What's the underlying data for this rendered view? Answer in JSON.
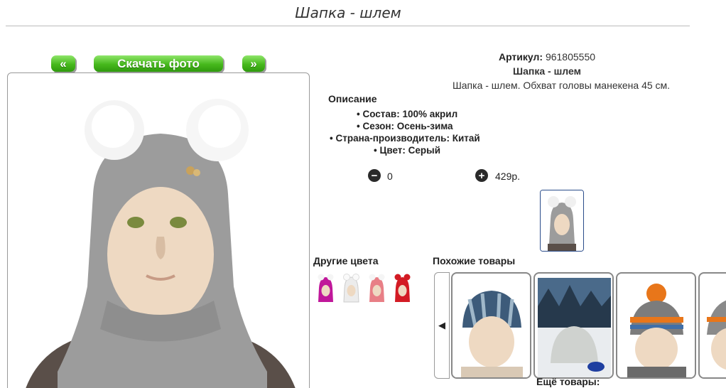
{
  "page": {
    "title": "Шапка - шлем"
  },
  "toolbar": {
    "prev_label": "«",
    "download_label": "Скачать фото",
    "next_label": "»"
  },
  "product": {
    "article_label": "Артикул:",
    "article_value": "961805550",
    "name": "Шапка - шлем",
    "description": "Шапка - шлем. Обхват головы манекена 45 см.",
    "details_title": "Описание",
    "specs": [
      "Состав: 100% акрил",
      "Сезон: Осень-зима",
      "Страна-производитель: Китай",
      "Цвет: Серый"
    ],
    "quantity": "0",
    "price": "429р."
  },
  "colors": {
    "accent": "#46b81c",
    "hat_gray": "#9a9a9a"
  },
  "other_colors": {
    "title": "Другие цвета",
    "items": [
      {
        "color": "#c0179a"
      },
      {
        "color": "#f2f2f2"
      },
      {
        "color": "#e87f86"
      },
      {
        "color": "#d31b24"
      }
    ]
  },
  "similar": {
    "title": "Похожие товары",
    "more_label": "Ещё товары:"
  }
}
